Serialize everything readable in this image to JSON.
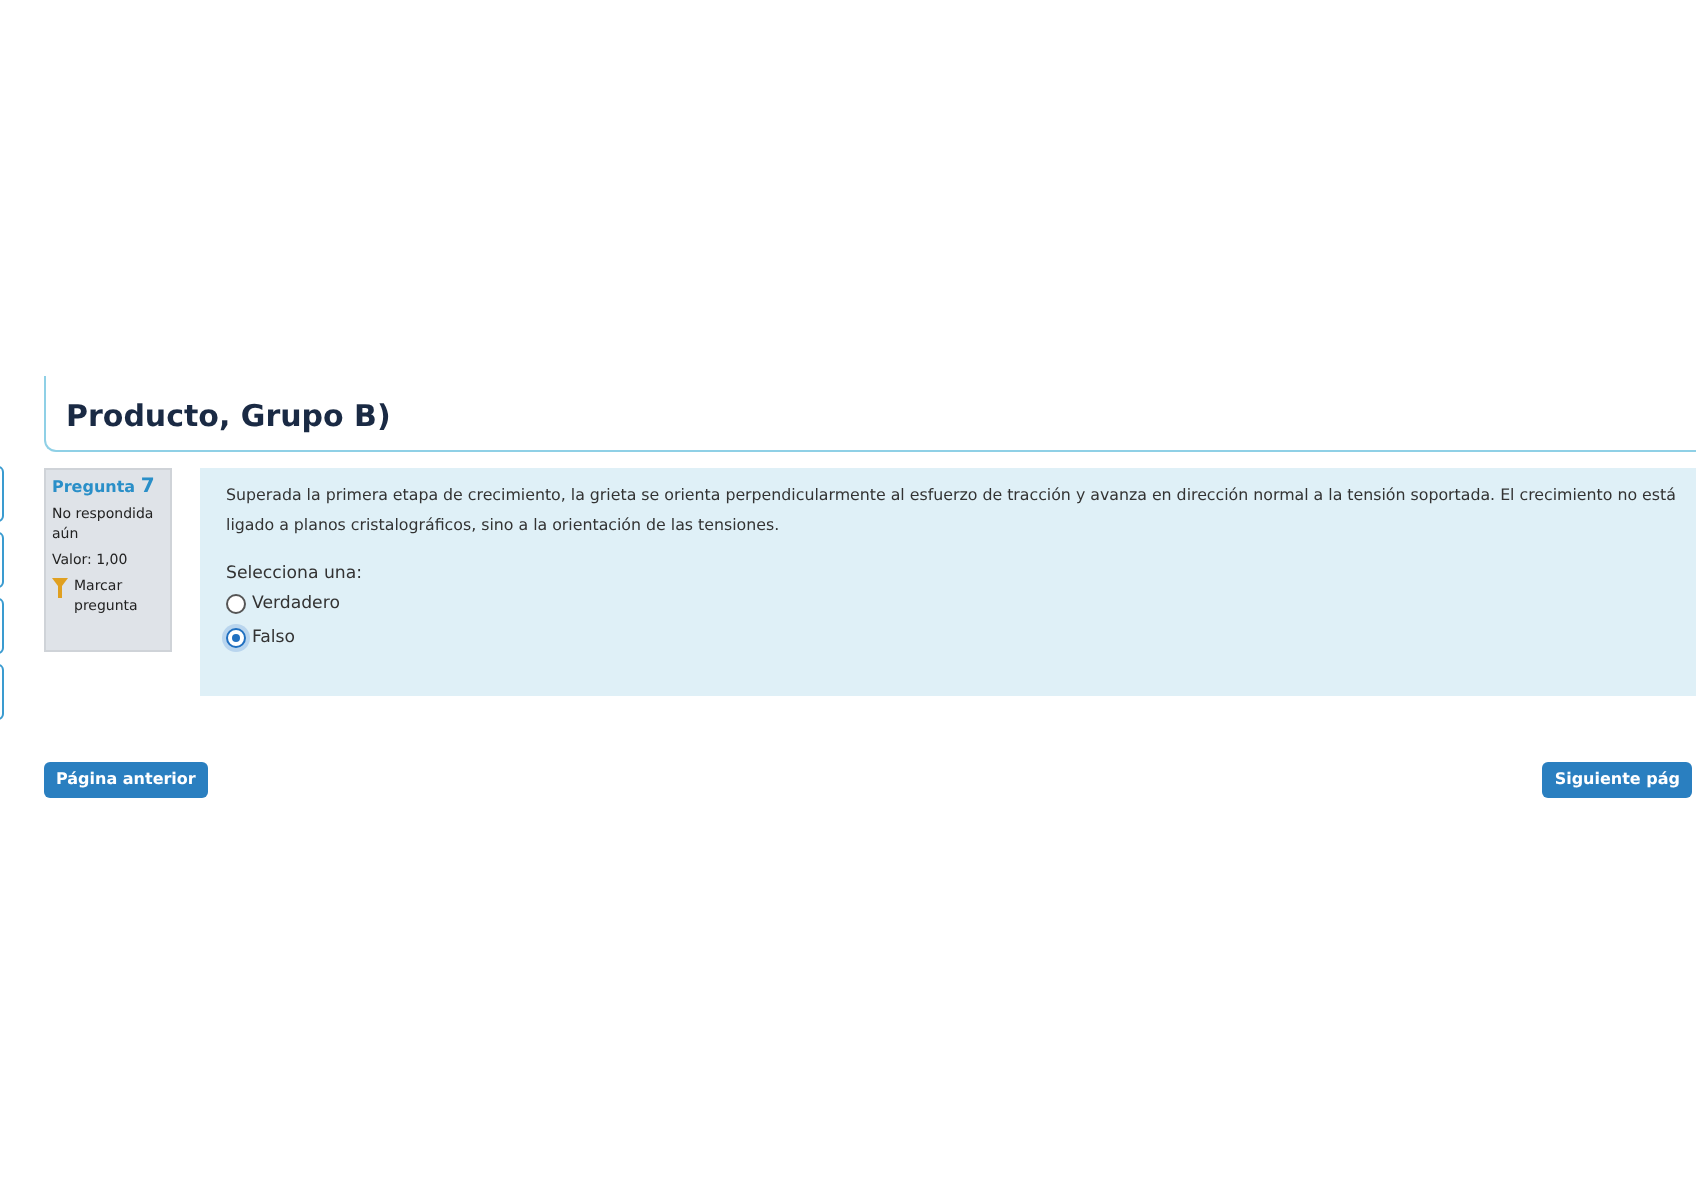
{
  "header": {
    "title": "Producto, Grupo B)"
  },
  "question_info": {
    "number_label": "Pregunta",
    "number": "7",
    "status": "No respondida aún",
    "grade": "Valor: 1,00",
    "flag": "Marcar pregunta"
  },
  "question": {
    "text": "Superada la primera etapa de crecimiento, la grieta se orienta perpendicularmente al esfuerzo de tracción y avanza en dirección normal a la tensión soportada. El crecimiento no está ligado a planos cristalográficos, sino a la orientación de las tensiones.",
    "prompt": "Selecciona una:",
    "options": [
      {
        "label": "Verdadero",
        "selected": false
      },
      {
        "label": "Falso",
        "selected": true
      }
    ]
  },
  "navigation": {
    "previous": "Página anterior",
    "next": "Siguiente pág"
  }
}
